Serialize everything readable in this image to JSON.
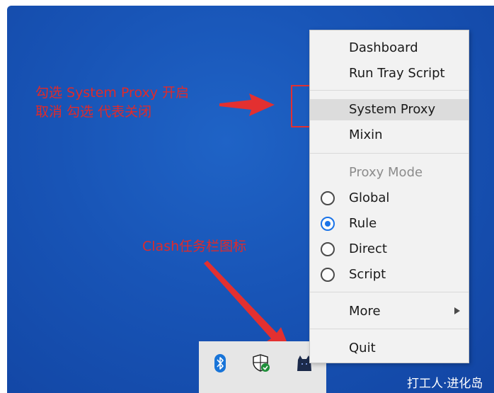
{
  "menu": {
    "items_top": [
      {
        "label": "Dashboard"
      },
      {
        "label": "Run Tray Script"
      }
    ],
    "system_proxy_label": "System Proxy",
    "mixin_label": "Mixin",
    "proxy_mode_header": "Proxy Mode",
    "modes": [
      {
        "label": "Global",
        "selected": false
      },
      {
        "label": "Rule",
        "selected": true
      },
      {
        "label": "Direct",
        "selected": false
      },
      {
        "label": "Script",
        "selected": false
      }
    ],
    "more_label": "More",
    "quit_label": "Quit"
  },
  "annotations": {
    "line1": "勾选 System Proxy 开启",
    "line2": "取消 勾选 代表关闭",
    "tray_label": "Clash任务栏图标"
  },
  "tray": {
    "icons": [
      "bluetooth-icon",
      "windows-security-icon",
      "clash-cat-icon"
    ]
  },
  "watermark": "打工人·进化岛",
  "colors": {
    "desktop": "#1854b6",
    "annotation": "#e02a2a",
    "radio_selected": "#1a73e8"
  }
}
